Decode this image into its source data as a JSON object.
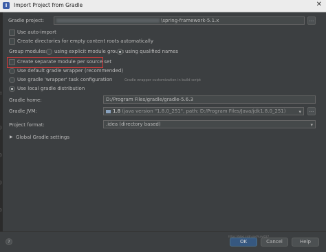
{
  "window": {
    "title": "Import Project from Gradle",
    "close": "✕"
  },
  "gradle_project": {
    "label": "Gradle project:",
    "value": "\\spring-framework-5.1.x"
  },
  "options": {
    "auto_import": "Use auto-import",
    "create_dirs": "Create directories for empty content roots automatically",
    "group_modules_label": "Group modules:",
    "group_explicit": "using explicit module groups",
    "group_qualified": "using qualified names",
    "separate_module": "Create separate module per source set",
    "default_wrapper": "Use default gradle wrapper (recommended)",
    "wrapper_task": "Use gradle 'wrapper' task configuration",
    "wrapper_hint": "Gradle wrapper customization in build script",
    "local_dist": "Use local gradle distribution"
  },
  "gradle_home": {
    "label": "Gradle home:",
    "value": "D:/Program Files/gradle/gradle-5.6.3"
  },
  "gradle_jvm": {
    "label": "Gradle JVM:",
    "version": "1.8",
    "detail": "(java version \"1.8.0_251\", path: D:/Program Files/Java/jdk1.8.0_251)"
  },
  "project_format": {
    "label": "Project format:",
    "value": ".idea (directory based)"
  },
  "global_settings": {
    "label": "Global Gradle settings"
  },
  "buttons": {
    "ok": "OK",
    "cancel": "Cancel",
    "help": "Help",
    "question": "?",
    "dots": "..."
  },
  "watermark": "https://blog.csdn.net/ruiyi027"
}
